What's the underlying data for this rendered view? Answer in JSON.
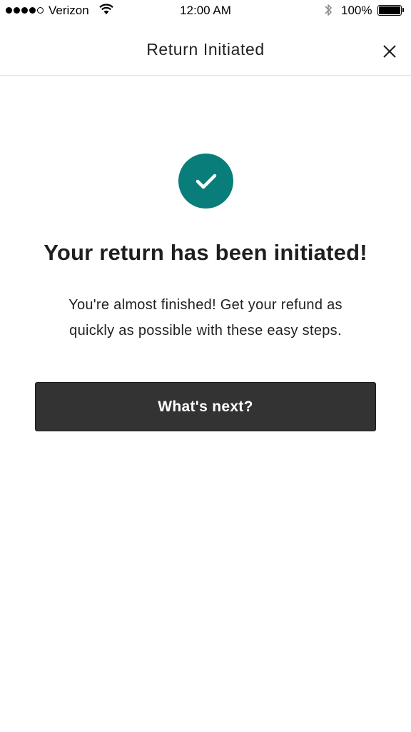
{
  "status_bar": {
    "carrier": "Verizon",
    "time": "12:00 AM",
    "battery_percent": "100%",
    "battery_level": 1.0,
    "signal_bars_filled": 4,
    "signal_bars_total": 5,
    "icons": [
      "signal-dots-icon",
      "wifi-icon",
      "bluetooth-icon",
      "battery-icon"
    ]
  },
  "header": {
    "title": "Return Initiated",
    "close_icon": "close-icon"
  },
  "main": {
    "status_icon": "checkmark-icon",
    "headline": "Your return has been initiated!",
    "subtext": "You're almost finished! Get your refund as quickly as possible with these easy steps.",
    "next_button_label": "What's next?"
  },
  "colors": {
    "accent": "#097d7a",
    "button_bg": "#333333",
    "text": "#1f1f1f",
    "divider": "#e3e3e3"
  }
}
